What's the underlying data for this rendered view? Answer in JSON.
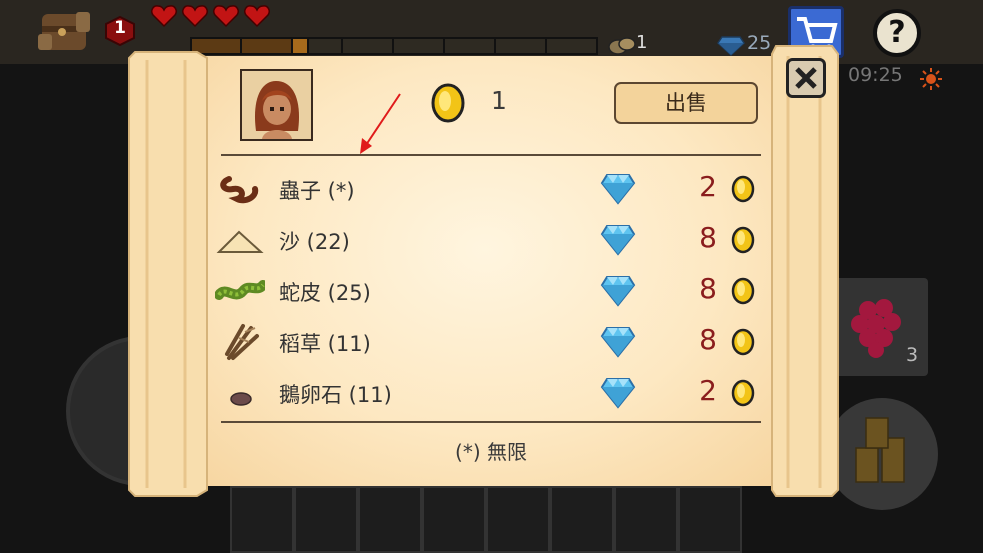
{
  "hud": {
    "level": "1",
    "hearts": 4,
    "xp_fraction": 0.28,
    "ore_count": "1",
    "gem_count": "25",
    "time": "09:25"
  },
  "background": {
    "inventory_slot_count": "3"
  },
  "shop": {
    "coin_count": "1",
    "sell_button_label": "出售",
    "items": [
      {
        "name": "蟲子 (*)",
        "price": "2",
        "icon": "worm-icon"
      },
      {
        "name": "沙 (22)",
        "price": "8",
        "icon": "sand-pile-icon"
      },
      {
        "name": "蛇皮 (25)",
        "price": "8",
        "icon": "snake-skin-icon"
      },
      {
        "name": "稻草 (11)",
        "price": "8",
        "icon": "straw-icon"
      },
      {
        "name": "鵝卵石 (11)",
        "price": "2",
        "icon": "pebble-icon"
      }
    ],
    "footnote": "(*) 無限"
  },
  "colors": {
    "price_red": "#8a1d1d",
    "parchment": "#fde8c2",
    "gem_blue": "#5ec4f0",
    "coin_gold": "#f2c417",
    "arrow_red": "#e01b1b"
  }
}
